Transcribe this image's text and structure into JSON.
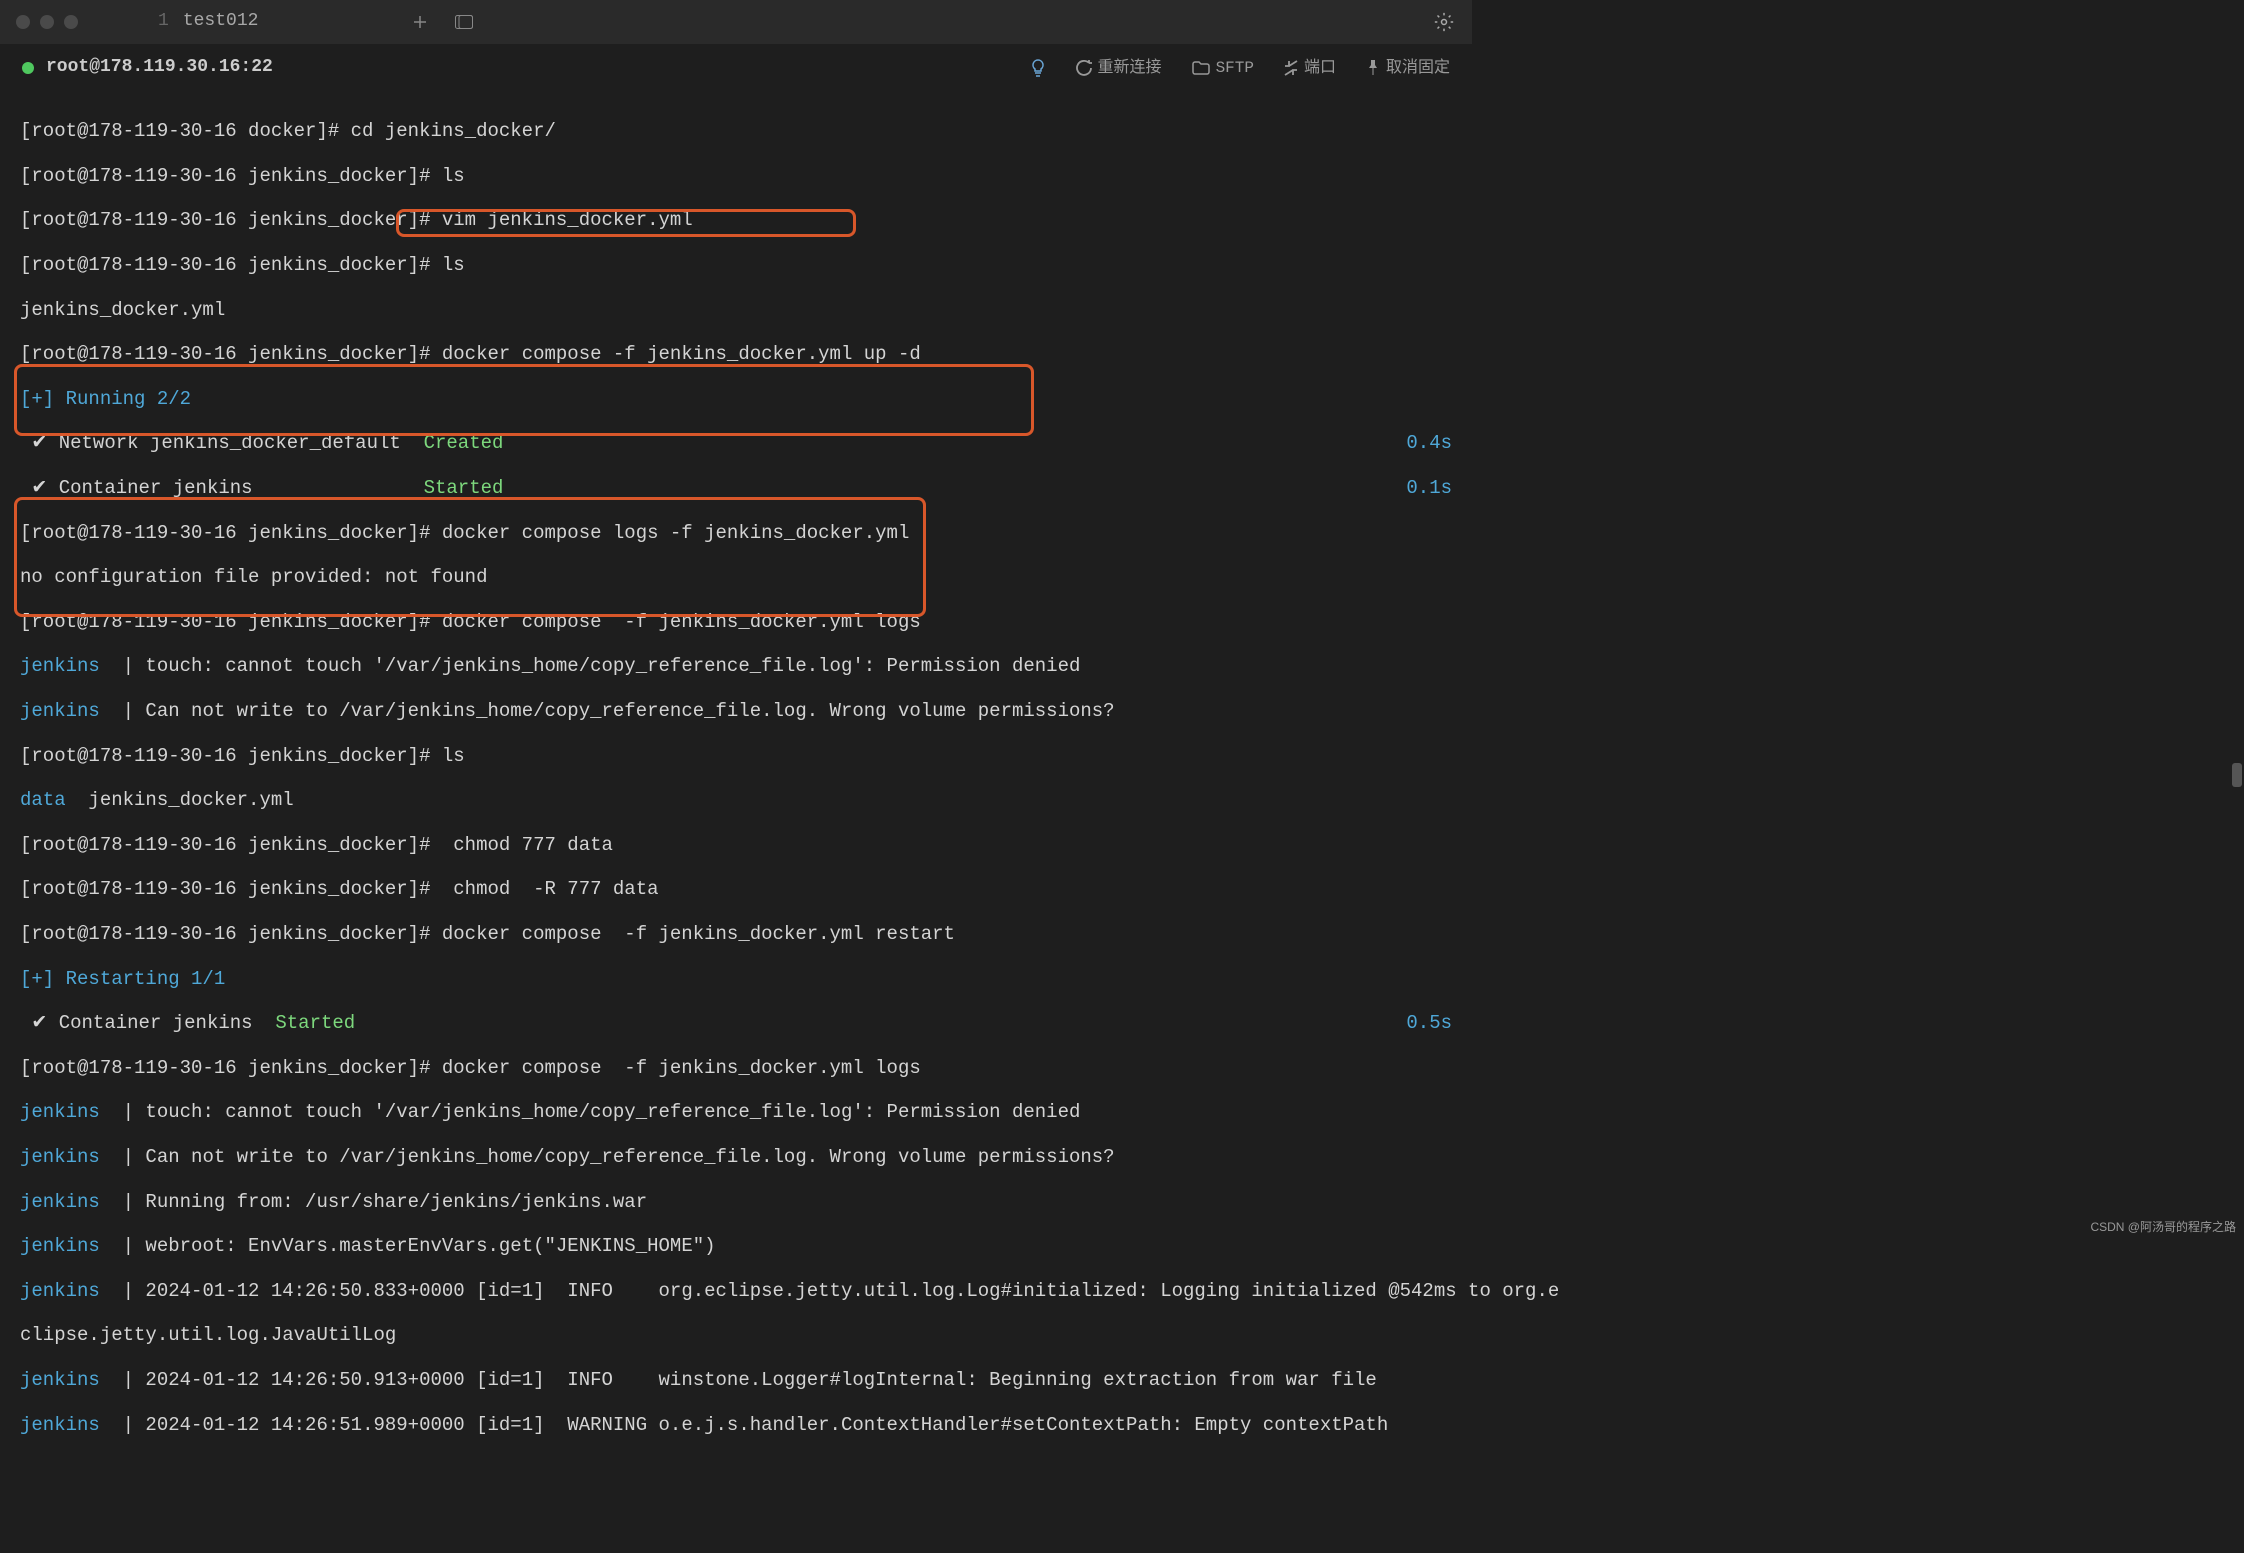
{
  "tab": {
    "number": "1",
    "name": "test012"
  },
  "connection": {
    "label": "root@178.119.30.16:22"
  },
  "conn_actions": {
    "reconnect": "重新连接",
    "sftp": "SFTP",
    "port": "端口",
    "unpin": "取消固定"
  },
  "lines": {
    "l1": "[root@178-119-30-16 docker]# cd jenkins_docker/",
    "l2": "[root@178-119-30-16 jenkins_docker]# ls",
    "l3": "[root@178-119-30-16 jenkins_docker]# vim jenkins_docker.yml",
    "l4": "[root@178-119-30-16 jenkins_docker]# ls",
    "l5": "jenkins_docker.yml",
    "l6p": "[root@178-119-30-16 jenkins_docker]# ",
    "l6c": "docker compose -f jenkins_docker.yml up -d",
    "l7": "[+] Running 2/2",
    "l8a": " ✔ Network jenkins_docker_default  ",
    "l8b": "Created",
    "l8t": "0.4s",
    "l9a": " ✔ Container jenkins               ",
    "l9b": "Started",
    "l9t": "0.1s",
    "l10": "[root@178-119-30-16 jenkins_docker]# docker compose logs -f jenkins_docker.yml",
    "l11": "no configuration file provided: not found",
    "l12": "[root@178-119-30-16 jenkins_docker]# docker compose  -f jenkins_docker.yml logs",
    "l13a": "jenkins  ",
    "l13b": "| touch: cannot touch '/var/jenkins_home/copy_reference_file.log': Permission denied",
    "l14a": "jenkins  ",
    "l14b": "| Can not write to /var/jenkins_home/copy_reference_file.log. Wrong volume permissions?",
    "l15": "[root@178-119-30-16 jenkins_docker]# ls",
    "l16a": "data",
    "l16b": "  jenkins_docker.yml",
    "l17": "[root@178-119-30-16 jenkins_docker]#  chmod 777 data",
    "l18": "[root@178-119-30-16 jenkins_docker]#  chmod  -R 777 data",
    "l19": "[root@178-119-30-16 jenkins_docker]# docker compose  -f jenkins_docker.yml restart",
    "l20": "[+] Restarting 1/1",
    "l21a": " ✔ Container jenkins  ",
    "l21b": "Started",
    "l21t": "0.5s",
    "l22": "[root@178-119-30-16 jenkins_docker]# docker compose  -f jenkins_docker.yml logs",
    "l23a": "jenkins  ",
    "l23b": "| touch: cannot touch '/var/jenkins_home/copy_reference_file.log': Permission denied",
    "l24a": "jenkins  ",
    "l24b": "| Can not write to /var/jenkins_home/copy_reference_file.log. Wrong volume permissions?",
    "l25a": "jenkins  ",
    "l25b": "| Running from: /usr/share/jenkins/jenkins.war",
    "l26a": "jenkins  ",
    "l26b": "| webroot: EnvVars.masterEnvVars.get(\"JENKINS_HOME\")",
    "l27a": "jenkins  ",
    "l27b": "| 2024-01-12 14:26:50.833+0000 [id=1]  INFO    org.eclipse.jetty.util.log.Log#initialized: Logging initialized @542ms to org.e",
    "l28": "clipse.jetty.util.log.JavaUtilLog",
    "l29a": "jenkins  ",
    "l29b": "| 2024-01-12 14:26:50.913+0000 [id=1]  INFO    winstone.Logger#logInternal: Beginning extraction from war file",
    "l30a": "jenkins  ",
    "l30b": "| 2024-01-12 14:26:51.989+0000 [id=1]  WARNING o.e.j.s.handler.ContextHandler#setContextPath: Empty contextPath"
  },
  "watermark": "CSDN @阿汤哥的程序之路"
}
